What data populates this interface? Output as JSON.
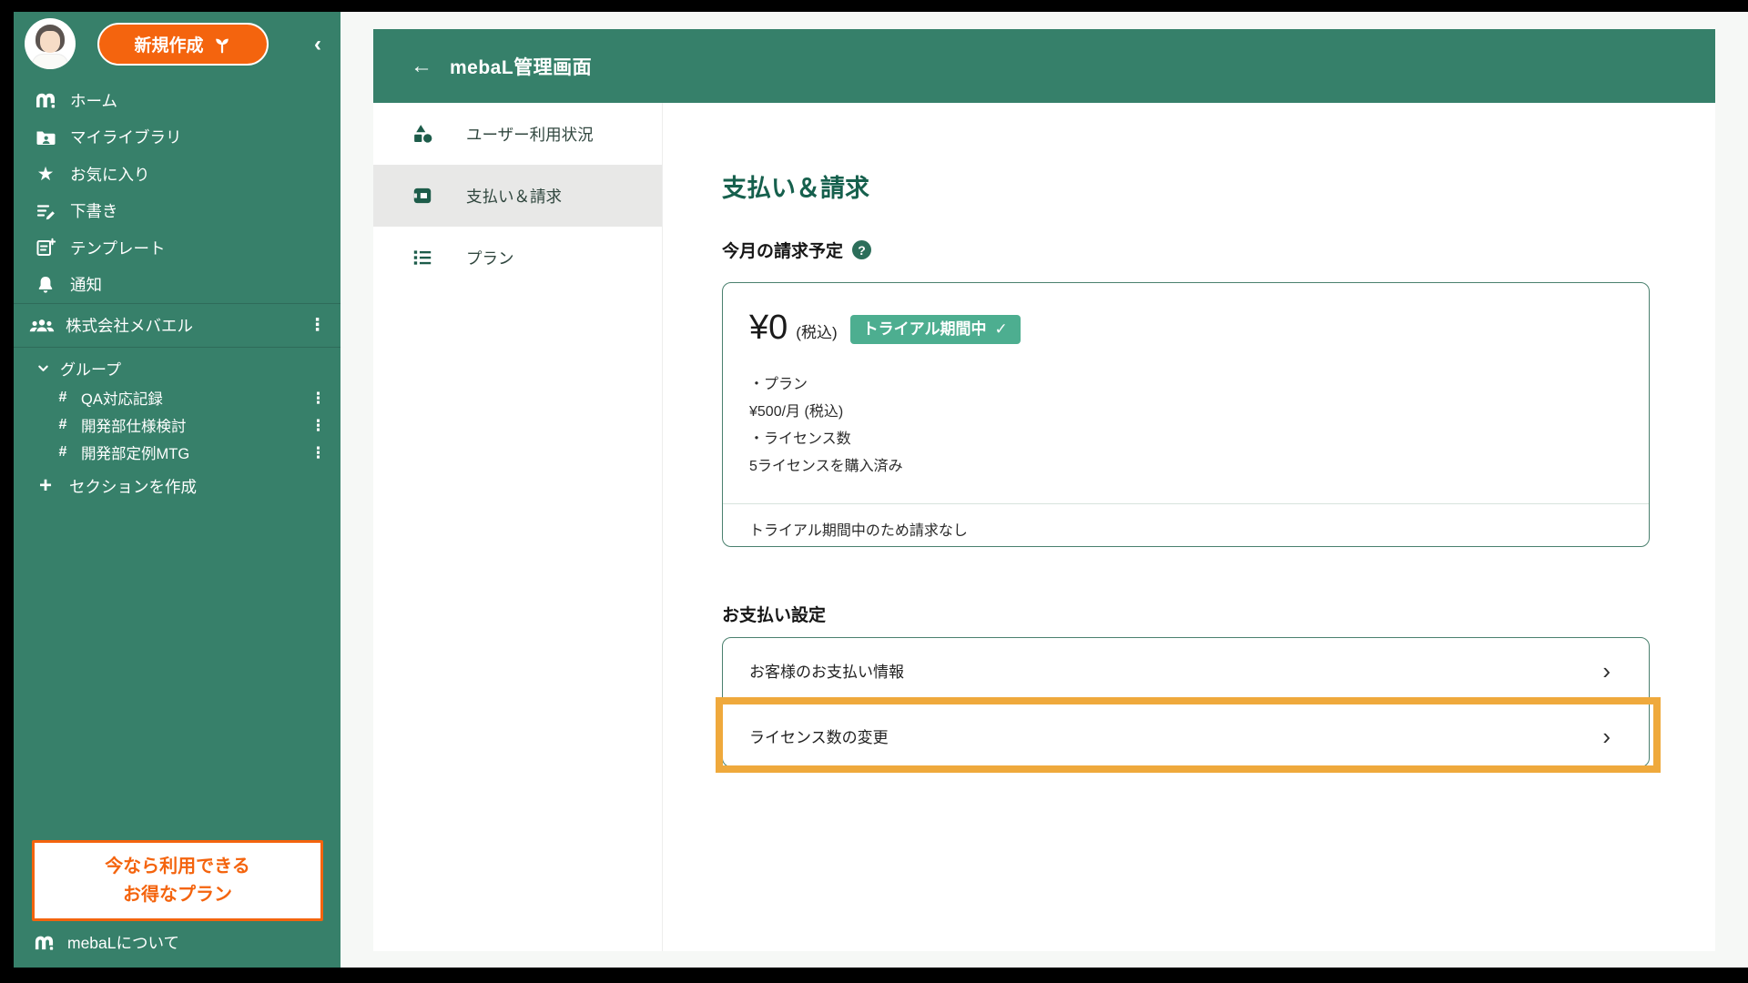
{
  "colors": {
    "sidebar_green": "#37806a",
    "header_green": "#36806a",
    "accent_orange": "#f4640e",
    "highlight_orange": "#efa93c",
    "title_green": "#16604d",
    "badge_green": "#4dae90",
    "selected_gray": "#e8e8e7",
    "card_border_green": "#4a806e"
  },
  "sidebar": {
    "new_button": {
      "label": "新規作成"
    },
    "nav": [
      {
        "label": "ホーム",
        "icon": "logo-m-icon"
      },
      {
        "label": "マイライブラリ",
        "icon": "folder-user-icon"
      },
      {
        "label": "お気に入り",
        "icon": "star-icon"
      },
      {
        "label": "下書き",
        "icon": "draft-pencil-icon"
      },
      {
        "label": "テンプレート",
        "icon": "template-plus-icon"
      },
      {
        "label": "通知",
        "icon": "bell-icon"
      }
    ],
    "workspace": {
      "label": "株式会社メバエル"
    },
    "group": {
      "label": "グループ",
      "items": [
        {
          "label": "QA対応記録"
        },
        {
          "label": "開発部仕様検討"
        },
        {
          "label": "開発部定例MTG"
        }
      ]
    },
    "create_section": {
      "label": "セクションを作成"
    },
    "promo": {
      "line1": "今なら利用できる",
      "line2": "お得なプラン"
    },
    "about": {
      "label": "mebaLについて"
    }
  },
  "admin_header": {
    "title": "mebaL管理画面"
  },
  "admin_nav": {
    "items": [
      {
        "label": "ユーザー利用状況",
        "icon": "shapes-icon",
        "selected": false
      },
      {
        "label": "支払い＆請求",
        "icon": "wallet-icon",
        "selected": true
      },
      {
        "label": "プラン",
        "icon": "list-icon",
        "selected": false
      }
    ]
  },
  "main": {
    "page_title": "支払い＆請求",
    "billing": {
      "heading": "今月の請求予定",
      "amount": "¥0",
      "tax_label": "(税込)",
      "badge_label": "トライアル期間中",
      "badge_check": "✓",
      "detail_lines": [
        "・プラン",
        "¥500/月 (税込)",
        "・ライセンス数",
        "5ライセンスを購入済み"
      ],
      "footer_note": "トライアル期間中のため請求なし"
    },
    "settings": {
      "heading": "お支払い設定",
      "rows": [
        {
          "label": "お客様のお支払い情報"
        },
        {
          "label": "ライセンス数の変更"
        }
      ]
    }
  },
  "glyphs": {
    "collapse": "‹",
    "back_arrow": "←",
    "star": "★",
    "kebab": "⋮",
    "hash": "#",
    "plus": "+",
    "chevron_right": "›",
    "question": "?"
  }
}
